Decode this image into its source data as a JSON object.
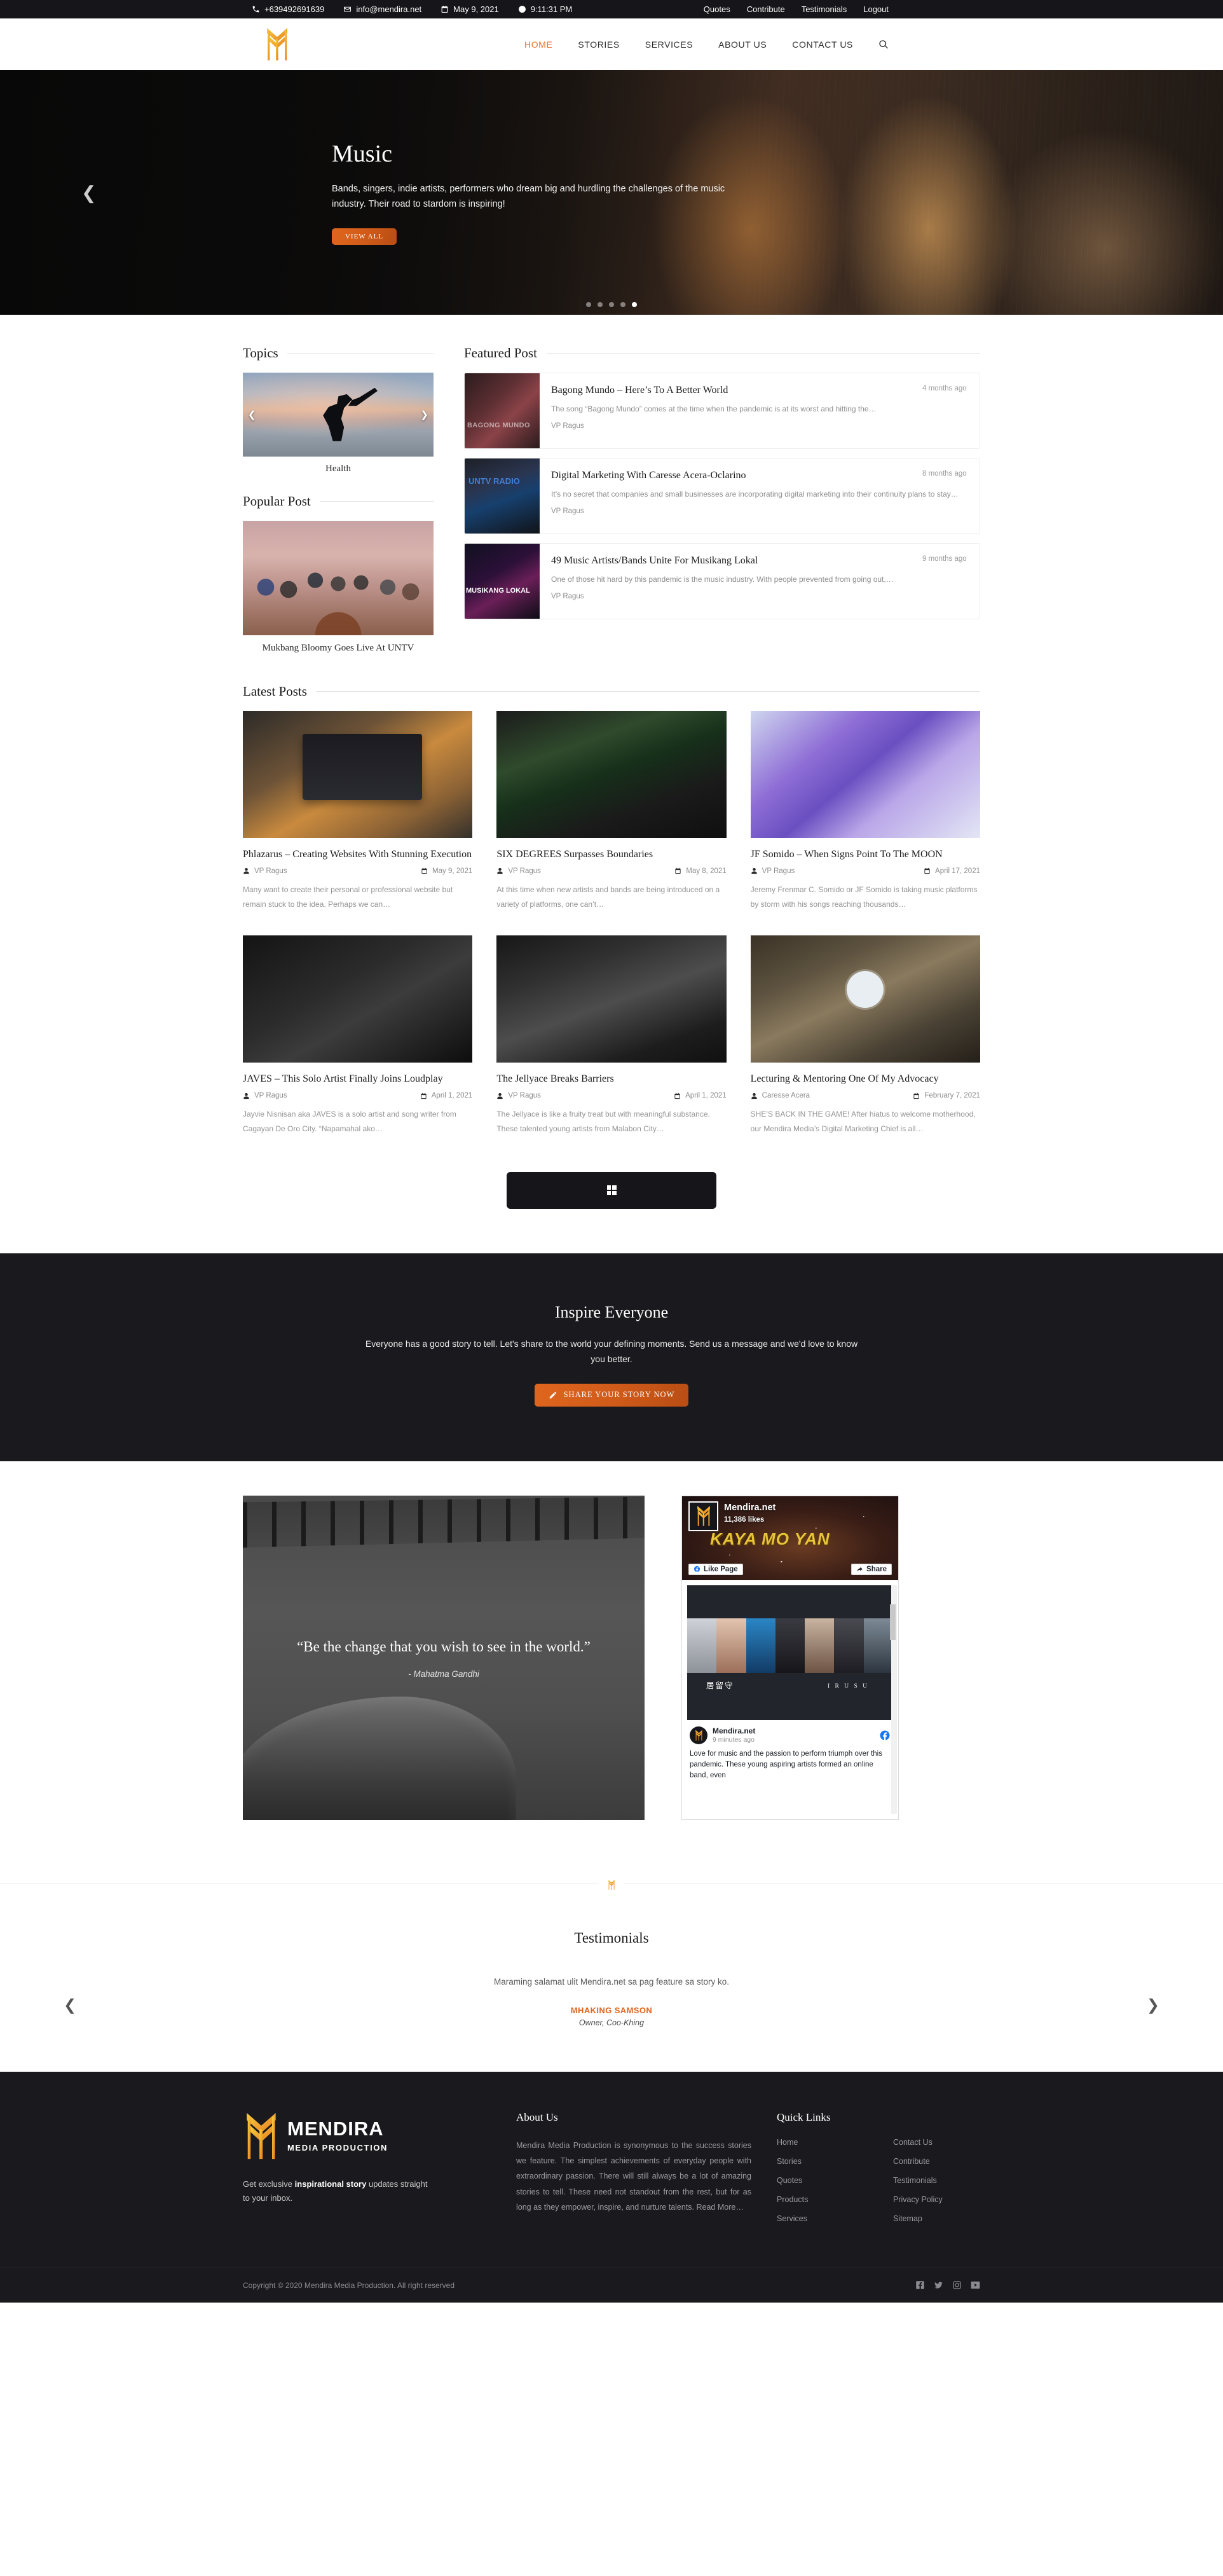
{
  "topbar": {
    "phone": "+639492691639",
    "email": "info@mendira.net",
    "date": "May 9, 2021",
    "time": "9:11:31 PM",
    "links": [
      {
        "label": "Quotes"
      },
      {
        "label": "Contribute"
      },
      {
        "label": "Testimonials"
      },
      {
        "label": "Logout"
      }
    ]
  },
  "nav": {
    "items": [
      {
        "label": "HOME",
        "active": true
      },
      {
        "label": "STORIES",
        "active": false
      },
      {
        "label": "SERVICES",
        "active": false
      },
      {
        "label": "ABOUT US",
        "active": false
      },
      {
        "label": "CONTACT US",
        "active": false
      }
    ],
    "search_icon": "search-icon"
  },
  "hero": {
    "title": "Music",
    "description": "Bands, singers, indie artists, performers who dream big and hurdling the challenges of the music industry. Their road to stardom is inspiring!",
    "button": "VIEW ALL",
    "dots": 5,
    "active_dot": 5
  },
  "topics": {
    "heading": "Topics",
    "current_label": "Health"
  },
  "popular": {
    "heading": "Popular Post",
    "title": "Mukbang Bloomy Goes Live At UNTV"
  },
  "featured": {
    "heading": "Featured Post",
    "posts": [
      {
        "title": "Bagong Mundo – Here’s To A Better World",
        "ago": "4 months ago",
        "excerpt": "The song “Bagong Mundo” comes at the time when the pandemic is at its worst and hitting the…",
        "author": "VP Ragus"
      },
      {
        "title": "Digital Marketing With Caresse Acera-Oclarino",
        "ago": "8 months ago",
        "excerpt": "It’s no secret that companies and small businesses are incorporating digital marketing into their continuity plans to stay…",
        "author": "VP Ragus"
      },
      {
        "title": "49 Music Artists/Bands Unite For Musikang Lokal",
        "ago": "9 months ago",
        "excerpt": "One of those hit hard by this pandemic is the music industry. With people prevented from going out,…",
        "author": "VP Ragus"
      }
    ]
  },
  "latest": {
    "heading": "Latest Posts",
    "posts": [
      {
        "title": "Phlazarus – Creating Websites With Stunning Execution",
        "author": "VP Ragus",
        "date": "May 9, 2021",
        "excerpt": "Many want to create their personal or professional website but remain stuck to the idea. Perhaps we can…"
      },
      {
        "title": "SIX DEGREES Surpasses Boundaries",
        "author": "VP Ragus",
        "date": "May 8, 2021",
        "excerpt": "At this time when new artists and bands are being introduced on a variety of platforms, one can’t…"
      },
      {
        "title": "JF Somido – When Signs Point To The MOON",
        "author": "VP Ragus",
        "date": "April 17, 2021",
        "excerpt": "Jeremy Frenmar C. Somido or JF Somido is taking music platforms by storm with his songs reaching thousands…"
      },
      {
        "title": "JAVES – This Solo Artist Finally Joins Loudplay",
        "author": "VP Ragus",
        "date": "April 1, 2021",
        "excerpt": "Jayvie Nisnisan aka JAVES is a solo artist and song writer from Cagayan De Oro City. “Napamahal ako…"
      },
      {
        "title": "The Jellyace Breaks Barriers",
        "author": "VP Ragus",
        "date": "April 1, 2021",
        "excerpt": "The Jellyace is like a fruity treat but with meaningful substance.  These talented young artists from Malabon City…"
      },
      {
        "title": "Lecturing & Mentoring One Of My Advocacy",
        "author": "Caresse Acera",
        "date": "February 7, 2021",
        "excerpt": "SHE’S BACK IN THE GAME! After hiatus to welcome motherhood, our Mendira Media’s Digital Marketing Chief is all…"
      }
    ]
  },
  "pager": {
    "icon": "grid-icon"
  },
  "inspire": {
    "title": "Inspire Everyone",
    "text": "Everyone has a good story to tell. Let's share to the world your defining moments. Send us a message and we'd love to know you better.",
    "button": "SHARE YOUR STORY NOW",
    "button_icon": "pencil-icon"
  },
  "quote": {
    "text": "“Be the change that you wish to see in the world.”",
    "author": "- Mahatma Gandhi"
  },
  "facebook": {
    "page_name": "Mendira.net",
    "likes": "11,386 likes",
    "cover_text": "KAYA MO YAN",
    "like_button": "Like Page",
    "share_button": "Share",
    "post_overlay_jp": "居留守",
    "post_overlay_romaji": "I R U S U",
    "post_author": "Mendira.net",
    "post_time": "9 minutes ago",
    "post_body": "Love for music and the passion to perform triumph over this pandemic. These young aspiring artists formed an online band, even"
  },
  "testimonials": {
    "heading": "Testimonials",
    "quote": "Maraming salamat ulit Mendira.net sa pag feature sa story ko.",
    "name": "MHAKING SAMSON",
    "role": "Owner, Coo-Khing"
  },
  "footer": {
    "brand_big": "MENDIRA",
    "brand_small": "MEDIA PRODUCTION",
    "newsletter_pre": "Get exclusive ",
    "newsletter_bold": "inspirational story",
    "newsletter_post": " updates straight to your inbox.",
    "about_heading": "About Us",
    "about_text": "Mendira Media Production is synonymous to the success stories we feature. The simplest achievements of everyday people with extraordinary passion. There will still always be a lot of amazing stories to tell. These need not standout from the rest, but for as long as they empower, inspire, and nurture talents. Read More…",
    "quick_heading": "Quick Links",
    "quick_links_col1": [
      {
        "label": "Home"
      },
      {
        "label": "Stories"
      },
      {
        "label": "Quotes"
      },
      {
        "label": "Products"
      },
      {
        "label": "Services"
      }
    ],
    "quick_links_col2": [
      {
        "label": "Contact Us"
      },
      {
        "label": "Contribute"
      },
      {
        "label": "Testimonials"
      },
      {
        "label": "Privacy Policy"
      },
      {
        "label": "Sitemap"
      }
    ],
    "copyright": "Copyright © 2020 Mendira Media Production. All right reserved",
    "socials": [
      "facebook-icon",
      "twitter-icon",
      "instagram-icon",
      "youtube-icon"
    ]
  },
  "colors": {
    "accent_orange": "#e0661e",
    "logo_gold": "#f2b927",
    "dark": "#1a1a1e"
  }
}
